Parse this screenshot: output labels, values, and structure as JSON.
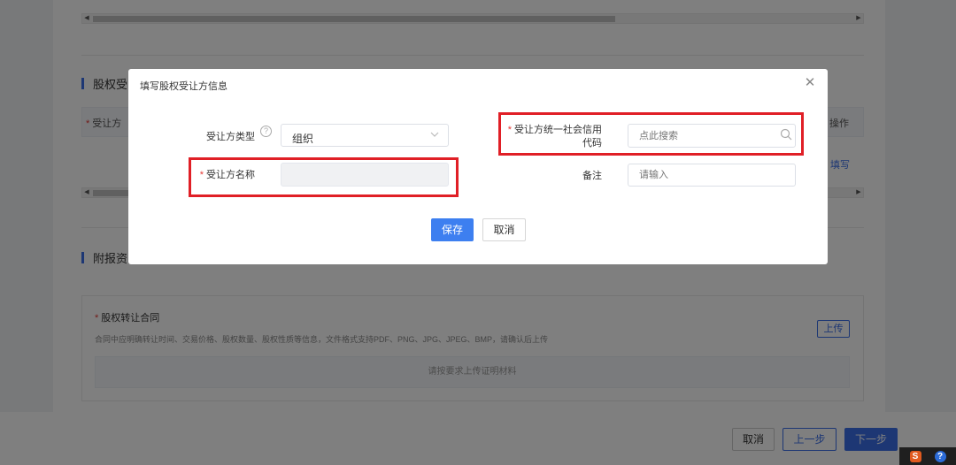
{
  "background": {
    "section_equity": "股权受",
    "table_col_transferee": "受让方",
    "table_col_action": "操作",
    "table_fill_link": "填写",
    "section_attachments": "附报资",
    "upload": {
      "title": "股权转让合同",
      "hint": "合同中应明确转让时间、交易价格、股权数量、股权性质等信息，文件格式支持PDF、PNG、JPG、JPEG、BMP，请确认后上传",
      "upload_button": "上传",
      "dropzone_text": "请按要求上传证明材料"
    },
    "footer": {
      "cancel": "取消",
      "prev": "上一步",
      "next": "下一步"
    },
    "required_mark": "*"
  },
  "modal": {
    "title": "填写股权受让方信息",
    "close_glyph": "✕",
    "fields": {
      "type_label": "受让方类型",
      "type_value": "组织",
      "name_label": "受让方名称",
      "name_value": "",
      "credit_code_label_line1": "受让方统一社会信用",
      "credit_code_label_line2": "代码",
      "credit_code_placeholder": "点此搜索",
      "remark_label": "备注",
      "remark_placeholder": "请输入"
    },
    "buttons": {
      "save": "保存",
      "cancel": "取消"
    },
    "help_glyph": "?",
    "chevron_glyph": "⌵"
  },
  "tray": {
    "s": "S",
    "q": "?"
  },
  "colors": {
    "primary": "#3d7ff0",
    "highlight_red": "#e01f26",
    "required_red": "#e53935"
  }
}
